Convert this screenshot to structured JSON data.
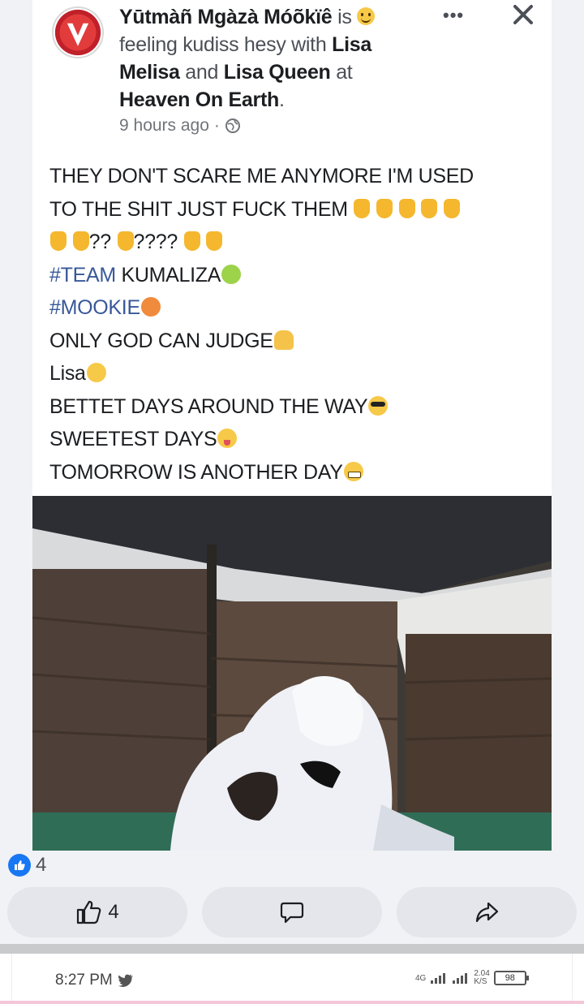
{
  "post": {
    "author": "Yūtmàñ Mgàzà Móõkïê",
    "is_word": "is",
    "feeling_text": "feeling kudiss hesy with",
    "tagged_1": "Lisa Melisa",
    "and_word": "and",
    "tagged_2": "Lisa Queen",
    "at_word": "at",
    "location": "Heaven On Earth",
    "period": ".",
    "timestamp": "9 hours ago",
    "separator": "·",
    "more_label": "•••",
    "lines": {
      "l1": "THEY DON'T SCARE ME ANYMORE I'M USED",
      "l2": "TO THE SHIT JUST FUCK THEM",
      "l3a": "??",
      "l3b": "????",
      "l4_hash": "#TEAM",
      "l4_rest": " KUMALIZA",
      "l5": "#MOOKIE",
      "l6": "ONLY GOD CAN JUDGE",
      "l7": "Lisa",
      "l8": "BETTET DAYS AROUND THE WAY",
      "l9": "SWEETEST DAYS",
      "l10": "TOMORROW IS ANOTHER DAY"
    }
  },
  "reactions": {
    "count": "4"
  },
  "actions": {
    "like_count": "4"
  },
  "status_bar": {
    "time": "8:27 PM",
    "network": "4G",
    "speed_value": "2.04",
    "speed_unit": "K/S",
    "battery": "98"
  },
  "colors": {
    "brand_blue": "#1877f2",
    "hashtag": "#385898"
  }
}
